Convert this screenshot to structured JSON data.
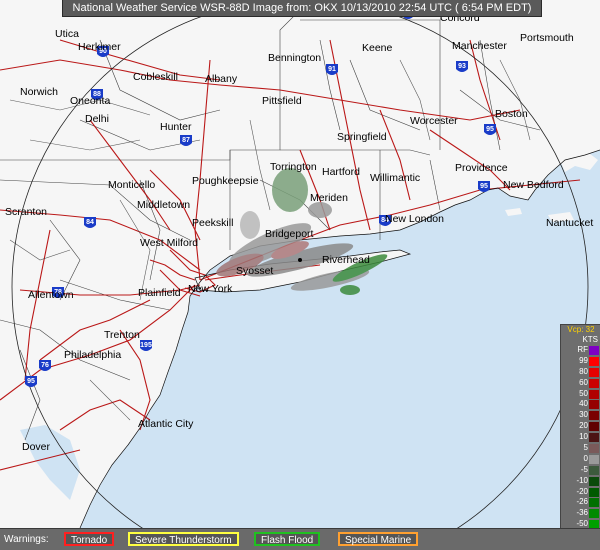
{
  "header": {
    "title": "National Weather Service WSR-88D Image from: OKX 10/13/2010 22:54 UTC ( 6:54 PM EDT)"
  },
  "map": {
    "cities": [
      {
        "name": "Utica"
      },
      {
        "name": "Herkimer"
      },
      {
        "name": "Cobleskill"
      },
      {
        "name": "Albany"
      },
      {
        "name": "Norwich"
      },
      {
        "name": "Oneonta"
      },
      {
        "name": "Delhi"
      },
      {
        "name": "Hunter"
      },
      {
        "name": "Bennington"
      },
      {
        "name": "Keene"
      },
      {
        "name": "Concord"
      },
      {
        "name": "Manchester"
      },
      {
        "name": "Portsmouth"
      },
      {
        "name": "Pittsfield"
      },
      {
        "name": "Worcester"
      },
      {
        "name": "Boston"
      },
      {
        "name": "Springfield"
      },
      {
        "name": "Torrington"
      },
      {
        "name": "Hartford"
      },
      {
        "name": "Willimantic"
      },
      {
        "name": "Providence"
      },
      {
        "name": "New Bedford"
      },
      {
        "name": "Monticello"
      },
      {
        "name": "Poughkeepsie"
      },
      {
        "name": "Middletown"
      },
      {
        "name": "Meriden"
      },
      {
        "name": "New London"
      },
      {
        "name": "Scranton"
      },
      {
        "name": "Peekskill"
      },
      {
        "name": "Nantucket"
      },
      {
        "name": "West Milford"
      },
      {
        "name": "Bridgeport"
      },
      {
        "name": "Riverhead"
      },
      {
        "name": "Syosset"
      },
      {
        "name": "Allentown"
      },
      {
        "name": "Plainfield"
      },
      {
        "name": "New York"
      },
      {
        "name": "Trenton"
      },
      {
        "name": "Philadelphia"
      },
      {
        "name": "Atlantic City"
      },
      {
        "name": "Dover"
      }
    ],
    "shields": [
      "90",
      "88",
      "87",
      "91",
      "93",
      "95",
      "84",
      "84",
      "95",
      "78",
      "195",
      "76",
      "95",
      "95"
    ]
  },
  "legend": {
    "title": "Vcp: 32",
    "units": "KTS",
    "entries": [
      {
        "label": "RF",
        "color": "#7f00c4"
      },
      {
        "label": "99",
        "color": "#ff0000"
      },
      {
        "label": "80",
        "color": "#e60000"
      },
      {
        "label": "60",
        "color": "#cc0000"
      },
      {
        "label": "50",
        "color": "#b00000"
      },
      {
        "label": "40",
        "color": "#960000"
      },
      {
        "label": "30",
        "color": "#7a0000"
      },
      {
        "label": "20",
        "color": "#600000"
      },
      {
        "label": "10",
        "color": "#4c1414"
      },
      {
        "label": "5",
        "color": "#7a5a5a"
      },
      {
        "label": "0",
        "color": "#9a9a9a"
      },
      {
        "label": "-5",
        "color": "#3c5a3c"
      },
      {
        "label": "-10",
        "color": "#0a4a0a"
      },
      {
        "label": "-20",
        "color": "#005a00"
      },
      {
        "label": "-26",
        "color": "#007000"
      },
      {
        "label": "-36",
        "color": "#008a00"
      },
      {
        "label": "-50",
        "color": "#00a000"
      },
      {
        "label": "-64",
        "color": "#00b400"
      },
      {
        "label": "-99",
        "color": "#00cc00"
      },
      {
        "label": "ND",
        "color": "#c8c8c8"
      }
    ]
  },
  "warnings": {
    "label": "Warnings:",
    "items": [
      {
        "label": "Tornado",
        "color": "#ff2020"
      },
      {
        "label": "Severe Thunderstorm",
        "color": "#ffff40"
      },
      {
        "label": "Flash Flood",
        "color": "#20c020"
      },
      {
        "label": "Special Marine",
        "color": "#ffa030"
      }
    ]
  }
}
